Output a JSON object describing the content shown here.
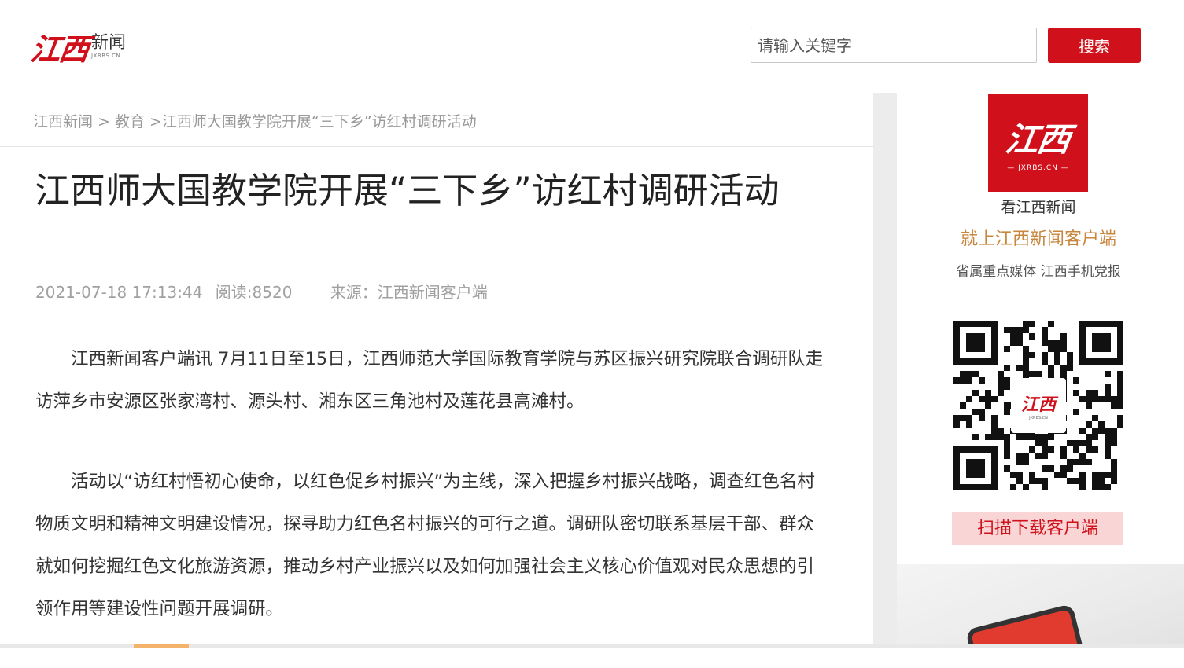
{
  "header": {
    "logo_mark": "江西",
    "logo_text": "新闻",
    "logo_sub": "JXRBS.CN",
    "search_placeholder": "请输入关键字",
    "search_button": "搜索"
  },
  "breadcrumb": {
    "home": "江西新闻",
    "sep1": ">",
    "category": "教育",
    "sep2": ">",
    "current": "江西师大国教学院开展“三下乡”访红村调研活动"
  },
  "article": {
    "title": "江西师大国教学院开展“三下乡”访红村调研活动",
    "datetime": "2021-07-18 17:13:44",
    "reads": "阅读:8520",
    "source": "来源：江西新闻客户端",
    "paragraphs": [
      "江西新闻客户端讯  7月11日至15日，江西师范大学国际教育学院与苏区振兴研究院联合调研队走访萍乡市安源区张家湾村、源头村、湘东区三角池村及莲花县高滩村。",
      "活动以“访红村悟初心使命，以红色促乡村振兴”为主线，深入把握乡村振兴战略，调查红色名村物质文明和精神文明建设情况，探寻助力红色名村振兴的可行之道。调研队密切联系基层干部、群众就如何挖掘红色文化旅游资源，推动乡村产业振兴以及如何加强社会主义核心价值观对民众思想的引领作用等建设性问题开展调研。"
    ]
  },
  "sidebar": {
    "app_logo_mark": "江西",
    "app_logo_sub": "— JXRBS.CN —",
    "line1": "看江西新闻",
    "line2": "就上江西新闻客户端",
    "line3": "省属重点媒体 江西手机党报",
    "qr_center_mark": "江西",
    "qr_center_sub": "JXRBS.CN",
    "download_button": "扫描下载客户端"
  },
  "colors": {
    "brand_red": "#d0111b",
    "accent_gold": "#c7873e",
    "download_bg": "#f9d5d5"
  }
}
